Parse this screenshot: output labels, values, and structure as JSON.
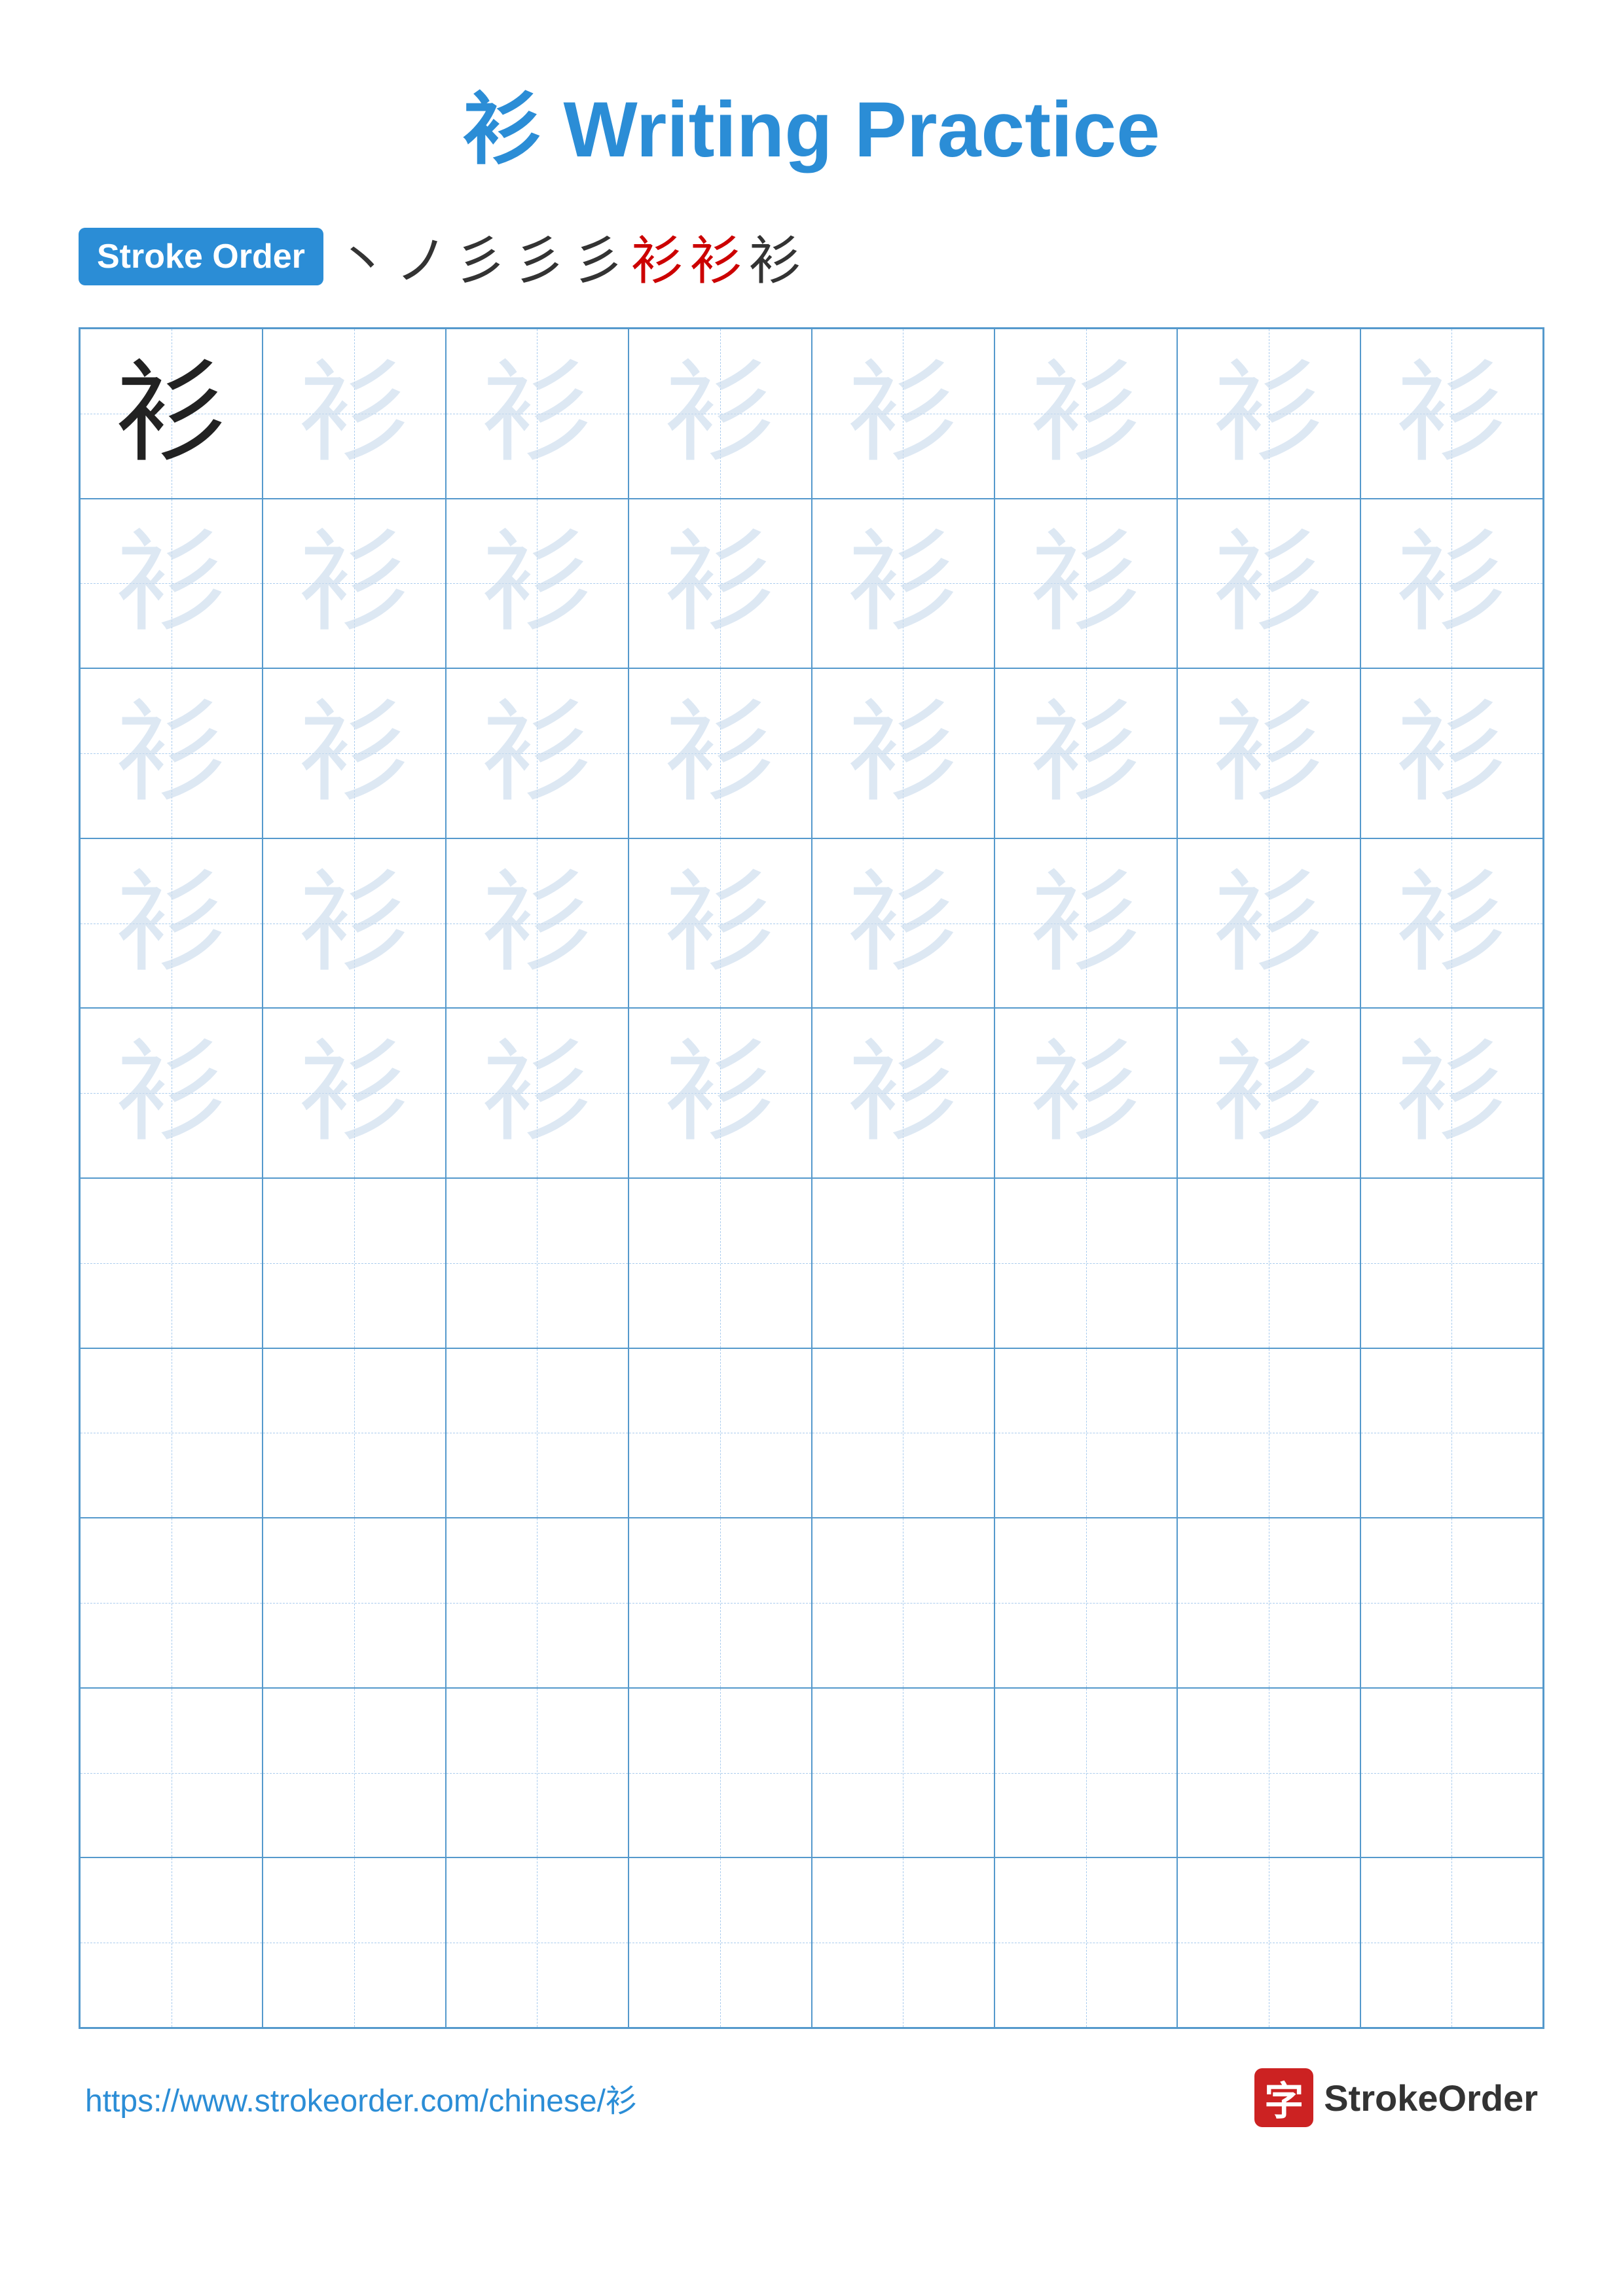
{
  "title": {
    "char": "衫",
    "label": "Writing Practice",
    "full": "衫 Writing Practice"
  },
  "stroke_order": {
    "badge_label": "Stroke Order",
    "strokes": [
      "丶",
      "ノ",
      "彡",
      "彡",
      "彡",
      "衫",
      "衫",
      "衫"
    ]
  },
  "grid": {
    "cols": 8,
    "rows": 10,
    "char": "衫",
    "practice_rows": 5,
    "empty_rows": 5
  },
  "footer": {
    "url": "https://www.strokeorder.com/chinese/衫",
    "logo_char": "字",
    "logo_name": "StrokeOrder"
  }
}
